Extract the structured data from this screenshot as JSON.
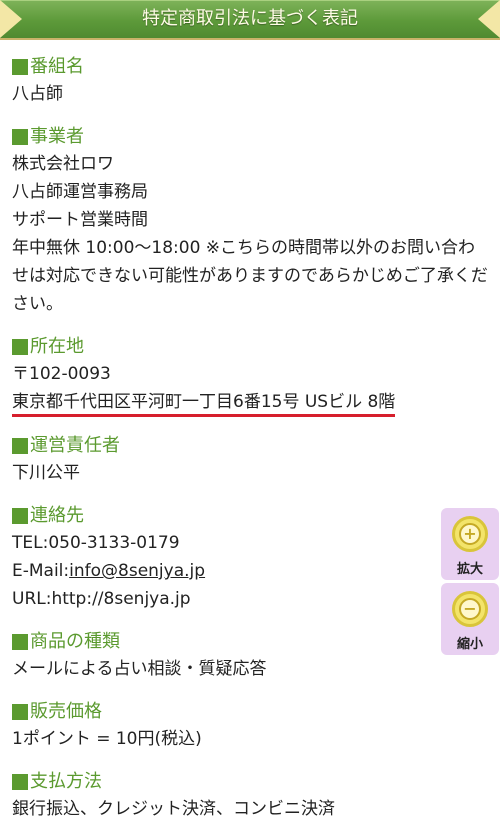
{
  "header": {
    "title": "特定商取引法に基づく表記"
  },
  "sections": [
    {
      "heading": "番組名",
      "lines": [
        "八占師"
      ]
    },
    {
      "heading": "事業者",
      "lines": [
        "株式会社ロワ",
        "八占師運営事務局",
        "サポート営業時間"
      ],
      "paragraph": "年中無休 10:00～18:00 ※こちらの時間帯以外のお問い合わせは対応できない可能性がありますのであらかじめご了承ください。"
    },
    {
      "heading": "所在地",
      "lines": [
        "〒102-0093"
      ],
      "address": "東京都千代田区平河町一丁目6番15号 USビル 8階"
    },
    {
      "heading": "運営責任者",
      "lines": [
        "下川公平"
      ]
    },
    {
      "heading": "連絡先",
      "tel": "TEL:050-3133-0179",
      "email_prefix": "E-Mail:",
      "email": "info@8senjya.jp",
      "url": "URL:http://8senjya.jp"
    },
    {
      "heading": "商品の種類",
      "lines": [
        "メールによる占い相談・質疑応答"
      ]
    },
    {
      "heading": "販売価格",
      "lines": [
        "1ポイント = 10円(税込)"
      ]
    },
    {
      "heading": "支払方法",
      "lines": [
        "銀行振込、クレジット決済、コンビニ決済"
      ]
    }
  ],
  "zoom": {
    "in_label": "拡大",
    "out_label": "縮小",
    "in_symbol": "+",
    "out_symbol": "−"
  }
}
